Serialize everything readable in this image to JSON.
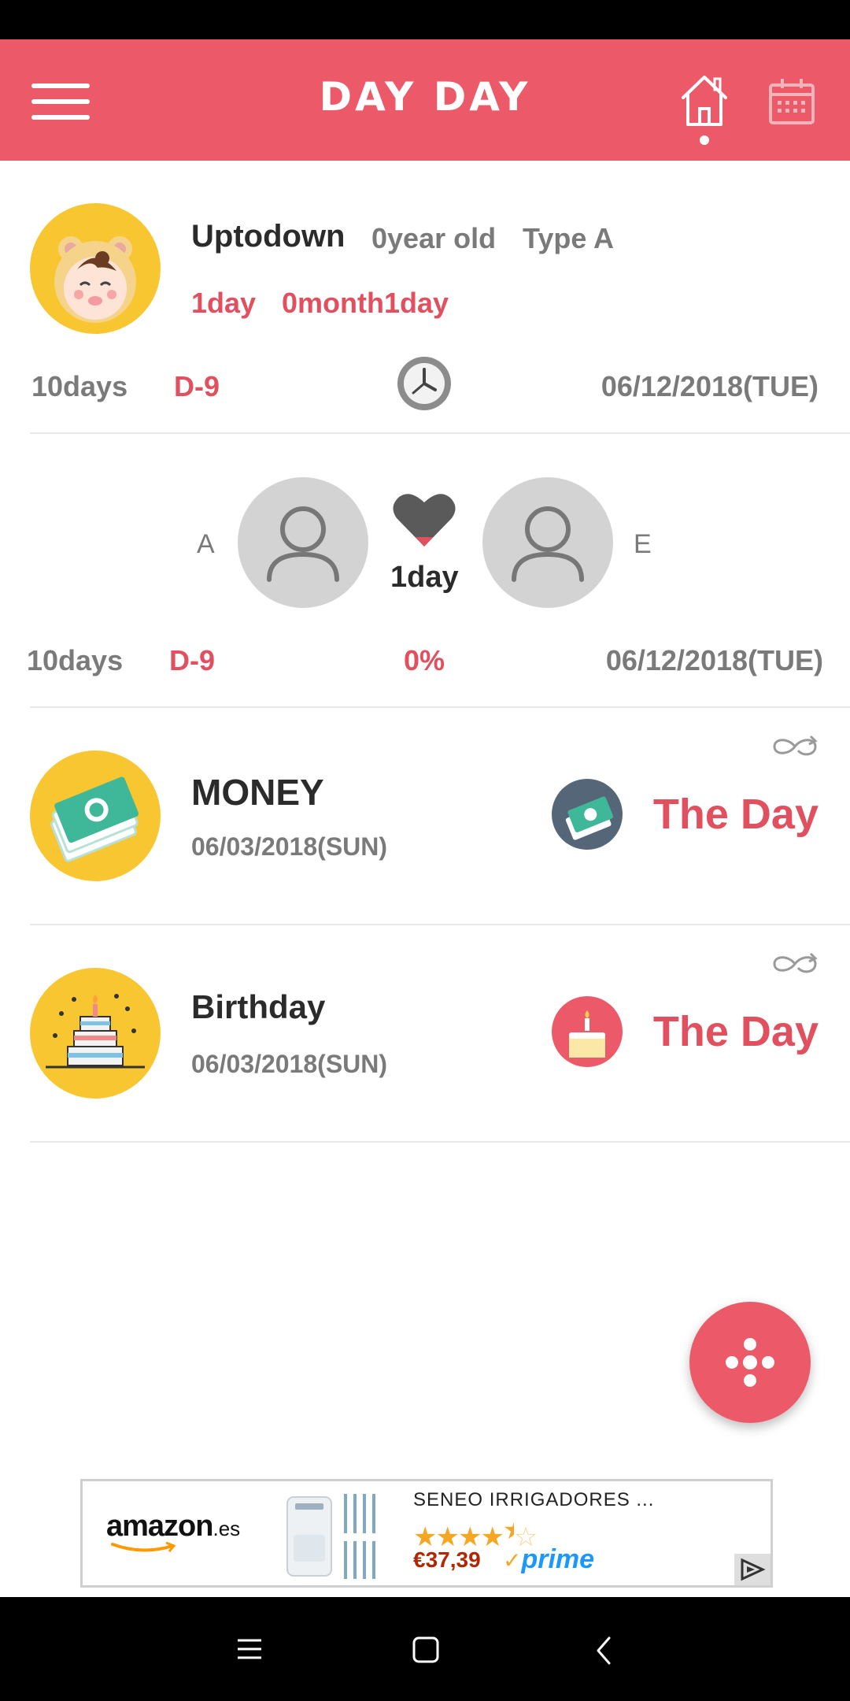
{
  "app": {
    "title": "DAY DAY"
  },
  "colors": {
    "accent": "#ec5a69",
    "pink_text": "#e0505f",
    "avatar_yellow": "#f8c630"
  },
  "icons": {
    "menu": "hamburger-icon",
    "home": "home-icon",
    "calendar": "calendar-icon",
    "clock": "clock-icon",
    "heart": "heart-icon",
    "repeat": "infinity-repeat-icon",
    "fab": "dots-flower-icon"
  },
  "baby_card": {
    "name": "Uptodown",
    "age": "0year old",
    "blood_type": "Type A",
    "days": "1day",
    "months_days": "0month1day",
    "count": "10days",
    "dday": "D-9",
    "date": "06/12/2018(TUE)"
  },
  "couple_card": {
    "left_initial": "A",
    "right_initial": "E",
    "together": "1day",
    "count": "10days",
    "dday": "D-9",
    "percent": "0%",
    "date": "06/12/2018(TUE)"
  },
  "events": [
    {
      "title": "MONEY",
      "date": "06/03/2018(SUN)",
      "status": "The Day"
    },
    {
      "title": "Birthday",
      "date": "06/03/2018(SUN)",
      "status": "The Day"
    }
  ],
  "ad": {
    "brand": "amazon",
    "brand_suffix": ".es",
    "product": "SENEO IRRIGADORES ...",
    "rating": 4.5,
    "price": "€37,39",
    "prime": "prime"
  }
}
